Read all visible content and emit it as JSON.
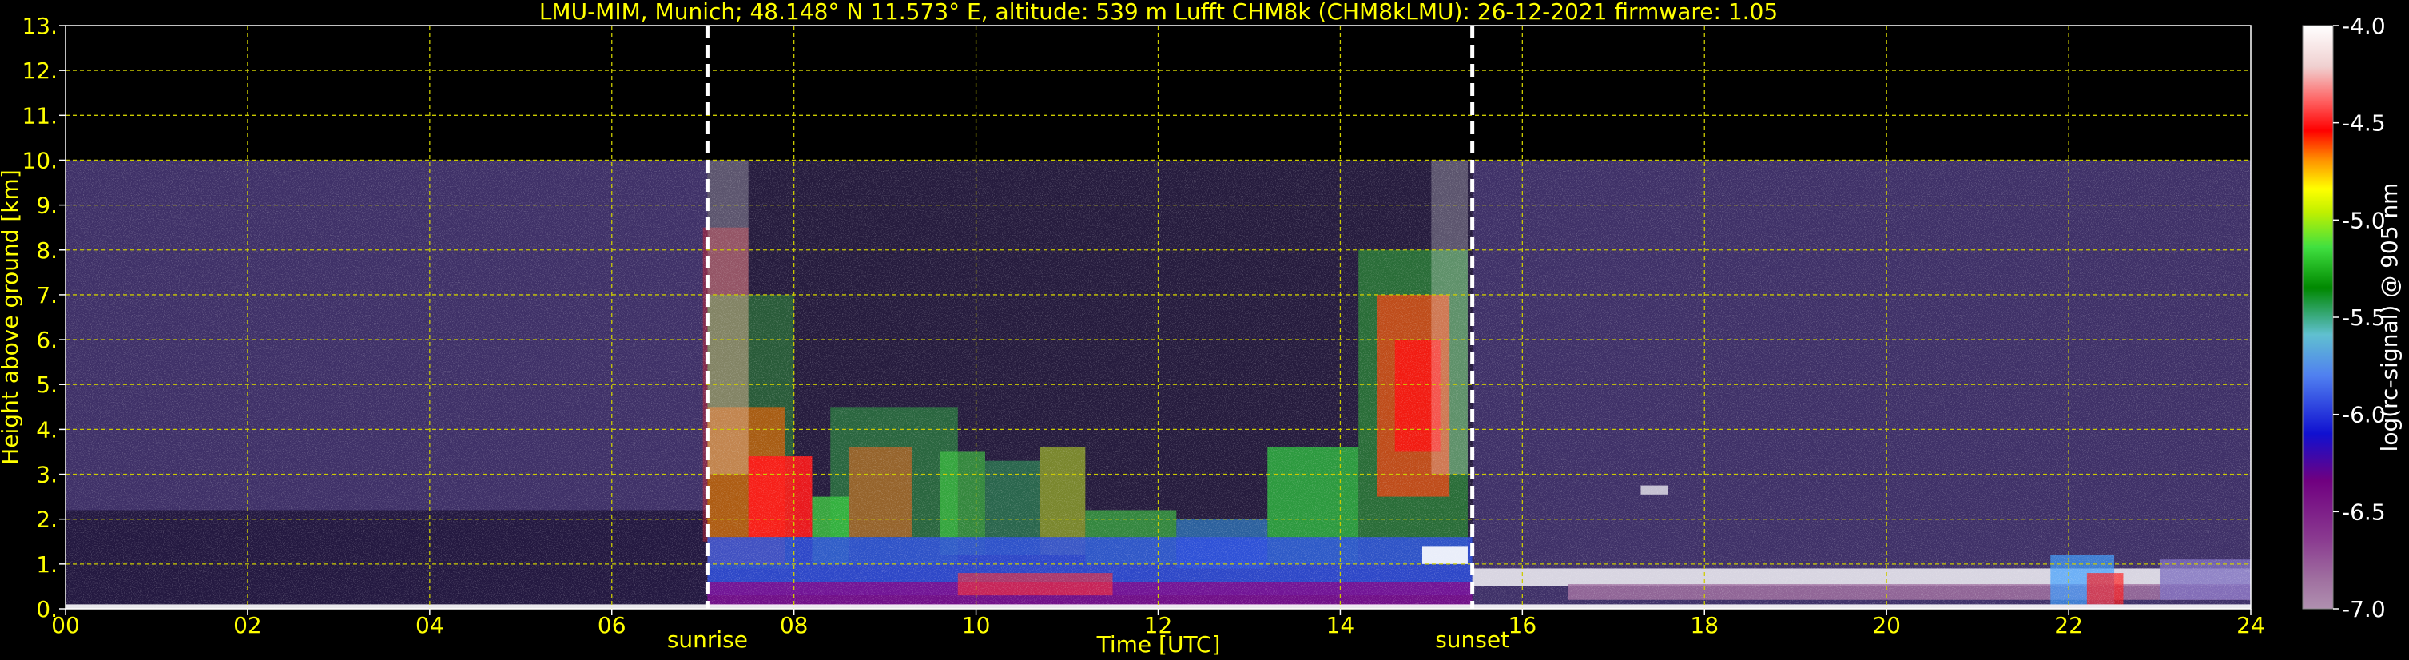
{
  "chart_data": {
    "type": "heatmap",
    "title": "LMU-MIM, Munich; 48.148° N 11.573° E, altitude: 539 m    Lufft CHM8k (CHM8kLMU): 26-12-2021    firmware: 1.05",
    "xlabel": "Time [UTC]",
    "ylabel": "Height above ground [km]",
    "xlim": [
      0,
      24
    ],
    "ylim": [
      0,
      13
    ],
    "x_ticks": [
      0,
      2,
      4,
      6,
      8,
      10,
      12,
      14,
      16,
      18,
      20,
      22,
      24
    ],
    "x_tick_labels": [
      "00",
      "02",
      "04",
      "06",
      "08",
      "10",
      "12",
      "14",
      "16",
      "18",
      "20",
      "22",
      "24"
    ],
    "y_ticks": [
      0,
      1,
      2,
      3,
      4,
      5,
      6,
      7,
      8,
      9,
      10,
      11,
      12,
      13
    ],
    "y_tick_labels": [
      "0.",
      "1.",
      "2.",
      "3.",
      "4.",
      "5.",
      "6.",
      "7.",
      "8.",
      "9.",
      "10.",
      "11.",
      "12.",
      "13."
    ],
    "grid": true,
    "data_max_height_km": 10,
    "events": [
      {
        "label": "sunrise",
        "time_utc": 7.05
      },
      {
        "label": "sunset",
        "time_utc": 15.45
      }
    ],
    "colorbar": {
      "label": "log(rc-signal) @ 905 nm",
      "ticks": [
        -4.0,
        -4.5,
        -5.0,
        -5.5,
        -6.0,
        -6.5,
        -7.0
      ],
      "tick_labels": [
        "-4.0",
        "-4.5",
        "-5.0",
        "-5.5",
        "-6.0",
        "-6.5",
        "-7.0"
      ],
      "range": [
        -7.0,
        -4.0
      ]
    },
    "colors": {
      "text": "#ffff00",
      "grid": "#cccc00",
      "event_line": "#ffffff",
      "background": "#000000"
    }
  }
}
